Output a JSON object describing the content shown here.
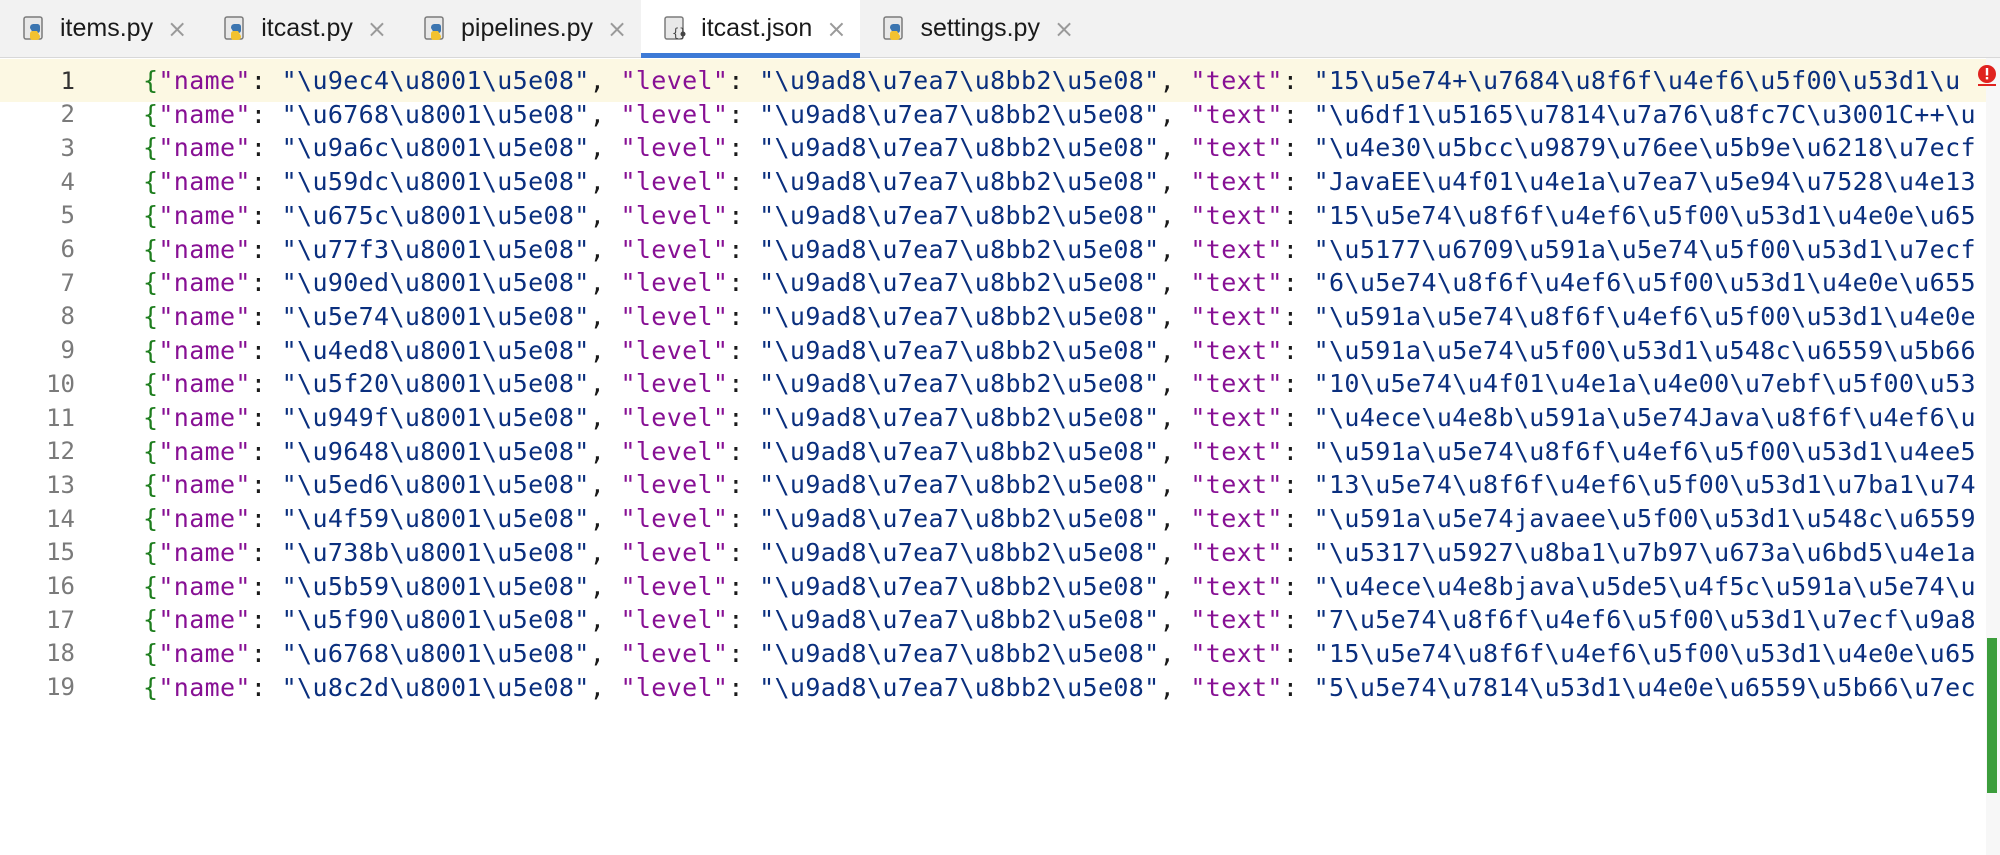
{
  "tabs": [
    {
      "label": "items.py",
      "icon": "python-file-icon",
      "active": false
    },
    {
      "label": "itcast.py",
      "icon": "python-file-icon",
      "active": false
    },
    {
      "label": "pipelines.py",
      "icon": "python-file-icon",
      "active": false
    },
    {
      "label": "itcast.json",
      "icon": "json-file-icon",
      "active": true
    },
    {
      "label": "settings.py",
      "icon": "python-file-icon",
      "active": false
    }
  ],
  "editor": {
    "current_line": 1,
    "lines": [
      {
        "num": "1",
        "name": "\\u9ec4\\u8001\\u5e08",
        "level": "\\u9ad8\\u7ea7\\u8bb2\\u5e08",
        "text": "15\\u5e74+\\u7684\\u8f6f\\u4ef6\\u5f00\\u53d1\\u"
      },
      {
        "num": "2",
        "name": "\\u6768\\u8001\\u5e08",
        "level": "\\u9ad8\\u7ea7\\u8bb2\\u5e08",
        "text": "\\u6df1\\u5165\\u7814\\u7a76\\u8fc7C\\u3001C++\\u"
      },
      {
        "num": "3",
        "name": "\\u9a6c\\u8001\\u5e08",
        "level": "\\u9ad8\\u7ea7\\u8bb2\\u5e08",
        "text": "\\u4e30\\u5bcc\\u9879\\u76ee\\u5b9e\\u6218\\u7ecf"
      },
      {
        "num": "4",
        "name": "\\u59dc\\u8001\\u5e08",
        "level": "\\u9ad8\\u7ea7\\u8bb2\\u5e08",
        "text": "JavaEE\\u4f01\\u4e1a\\u7ea7\\u5e94\\u7528\\u4e13"
      },
      {
        "num": "5",
        "name": "\\u675c\\u8001\\u5e08",
        "level": "\\u9ad8\\u7ea7\\u8bb2\\u5e08",
        "text": "15\\u5e74\\u8f6f\\u4ef6\\u5f00\\u53d1\\u4e0e\\u65"
      },
      {
        "num": "6",
        "name": "\\u77f3\\u8001\\u5e08",
        "level": "\\u9ad8\\u7ea7\\u8bb2\\u5e08",
        "text": "\\u5177\\u6709\\u591a\\u5e74\\u5f00\\u53d1\\u7ecf"
      },
      {
        "num": "7",
        "name": "\\u90ed\\u8001\\u5e08",
        "level": "\\u9ad8\\u7ea7\\u8bb2\\u5e08",
        "text": "6\\u5e74\\u8f6f\\u4ef6\\u5f00\\u53d1\\u4e0e\\u655"
      },
      {
        "num": "8",
        "name": "\\u5e74\\u8001\\u5e08",
        "level": "\\u9ad8\\u7ea7\\u8bb2\\u5e08",
        "text": "\\u591a\\u5e74\\u8f6f\\u4ef6\\u5f00\\u53d1\\u4e0e"
      },
      {
        "num": "9",
        "name": "\\u4ed8\\u8001\\u5e08",
        "level": "\\u9ad8\\u7ea7\\u8bb2\\u5e08",
        "text": "\\u591a\\u5e74\\u5f00\\u53d1\\u548c\\u6559\\u5b66"
      },
      {
        "num": "10",
        "name": "\\u5f20\\u8001\\u5e08",
        "level": "\\u9ad8\\u7ea7\\u8bb2\\u5e08",
        "text": "10\\u5e74\\u4f01\\u4e1a\\u4e00\\u7ebf\\u5f00\\u53"
      },
      {
        "num": "11",
        "name": "\\u949f\\u8001\\u5e08",
        "level": "\\u9ad8\\u7ea7\\u8bb2\\u5e08",
        "text": "\\u4ece\\u4e8b\\u591a\\u5e74Java\\u8f6f\\u4ef6\\u"
      },
      {
        "num": "12",
        "name": "\\u9648\\u8001\\u5e08",
        "level": "\\u9ad8\\u7ea7\\u8bb2\\u5e08",
        "text": "\\u591a\\u5e74\\u8f6f\\u4ef6\\u5f00\\u53d1\\u4ee5"
      },
      {
        "num": "13",
        "name": "\\u5ed6\\u8001\\u5e08",
        "level": "\\u9ad8\\u7ea7\\u8bb2\\u5e08",
        "text": "13\\u5e74\\u8f6f\\u4ef6\\u5f00\\u53d1\\u7ba1\\u74"
      },
      {
        "num": "14",
        "name": "\\u4f59\\u8001\\u5e08",
        "level": "\\u9ad8\\u7ea7\\u8bb2\\u5e08",
        "text": "\\u591a\\u5e74javaee\\u5f00\\u53d1\\u548c\\u6559"
      },
      {
        "num": "15",
        "name": "\\u738b\\u8001\\u5e08",
        "level": "\\u9ad8\\u7ea7\\u8bb2\\u5e08",
        "text": "\\u5317\\u5927\\u8ba1\\u7b97\\u673a\\u6bd5\\u4e1a"
      },
      {
        "num": "16",
        "name": "\\u5b59\\u8001\\u5e08",
        "level": "\\u9ad8\\u7ea7\\u8bb2\\u5e08",
        "text": "\\u4ece\\u4e8bjava\\u5de5\\u4f5c\\u591a\\u5e74\\u"
      },
      {
        "num": "17",
        "name": "\\u5f90\\u8001\\u5e08",
        "level": "\\u9ad8\\u7ea7\\u8bb2\\u5e08",
        "text": "7\\u5e74\\u8f6f\\u4ef6\\u5f00\\u53d1\\u7ecf\\u9a8"
      },
      {
        "num": "18",
        "name": "\\u6768\\u8001\\u5e08",
        "level": "\\u9ad8\\u7ea7\\u8bb2\\u5e08",
        "text": "15\\u5e74\\u8f6f\\u4ef6\\u5f00\\u53d1\\u4e0e\\u65"
      },
      {
        "num": "19",
        "name": "\\u8c2d\\u8001\\u5e08",
        "level": "\\u9ad8\\u7ea7\\u8bb2\\u5e08",
        "text": "5\\u5e74\\u7814\\u53d1\\u4e0e\\u6559\\u5b66\\u7ec"
      }
    ],
    "tokens": {
      "open_brace": "{",
      "quote": "\"",
      "name_key": "\"name\"",
      "level_key": "\"level\"",
      "text_key": "\"text\"",
      "colon": ": ",
      "comma": ", "
    }
  },
  "colors": {
    "key": "#871094",
    "string": "#0a2f7e",
    "brace": "#1d7d1d",
    "tab_accent": "#3d7ad6",
    "current_line": "#fcf8e3",
    "error": "#e0231f"
  }
}
